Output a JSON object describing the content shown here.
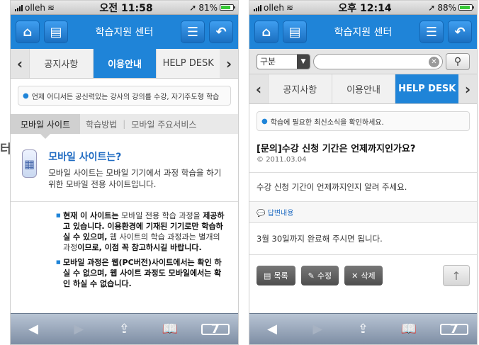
{
  "side_char": "터",
  "screen1": {
    "status": {
      "carrier": "olleh",
      "time": "오전 11:58",
      "battery": "81%",
      "battery_level": 81
    },
    "header": {
      "title": "학습지원 센터"
    },
    "tabs": [
      "공지사항",
      "이용안내",
      "HELP DESK"
    ],
    "active_tab": 1,
    "notice": "언제 어디서든 공신력있는 강사의 강의를 수강, 자기주도형 학습",
    "subtabs": [
      "모바일 사이트",
      "학습방법",
      "모바일 주요서비스"
    ],
    "mobile_title": "모바일 사이트는?",
    "mobile_desc": "모바일 사이트는 모바일 기기에서 과정 학습을 하기 위한 모바일 전용 사이트입니다.",
    "bullets": [
      {
        "bold": "현재 이 사이트는",
        "text": " 모바일 전용 학습 과정을 ",
        "bold2": "제공하고 있습니다. 이용환경에 기재된 기기로만 학습하실 수 있으며,",
        "text2": " 웹 사이트의 학습 과정과는 별개의 과정",
        "bold3": "이므로, 이점 꼭 참고하시길 바랍니다."
      },
      {
        "bold": "모바일 과정은 웹(PC버전)사이트에서는 확인 하실 수 없으며, 웹 사이트 과정도 모바일에서는 확인 하실 수 없습니다.",
        "text": "",
        "bold2": "",
        "text2": "",
        "bold3": ""
      }
    ],
    "toolbar_tabs": "7"
  },
  "screen2": {
    "status": {
      "carrier": "olleh",
      "time": "오후 12:14",
      "battery": "88%",
      "battery_level": 88
    },
    "header": {
      "title": "학습지원 센터"
    },
    "search": {
      "select": "구분",
      "placeholder": ""
    },
    "tabs": [
      "공지사항",
      "이용안내",
      "HELP DESK"
    ],
    "active_tab": 2,
    "notice": "학습에 필요한 최신소식을 확인하세요.",
    "question_title": "[문의]수강 신청 기간은 언제까지인가요?",
    "question_date": "2011.03.04",
    "question_body": "수강 신청 기간이 언제까지인지 알려 주세요.",
    "answer_label": "답변내용",
    "answer_body": "3월 30일까지 완료해 주시면 됩니다.",
    "buttons": {
      "list": "목록",
      "edit": "수정",
      "delete": "삭제"
    },
    "toolbar_tabs": "7"
  }
}
